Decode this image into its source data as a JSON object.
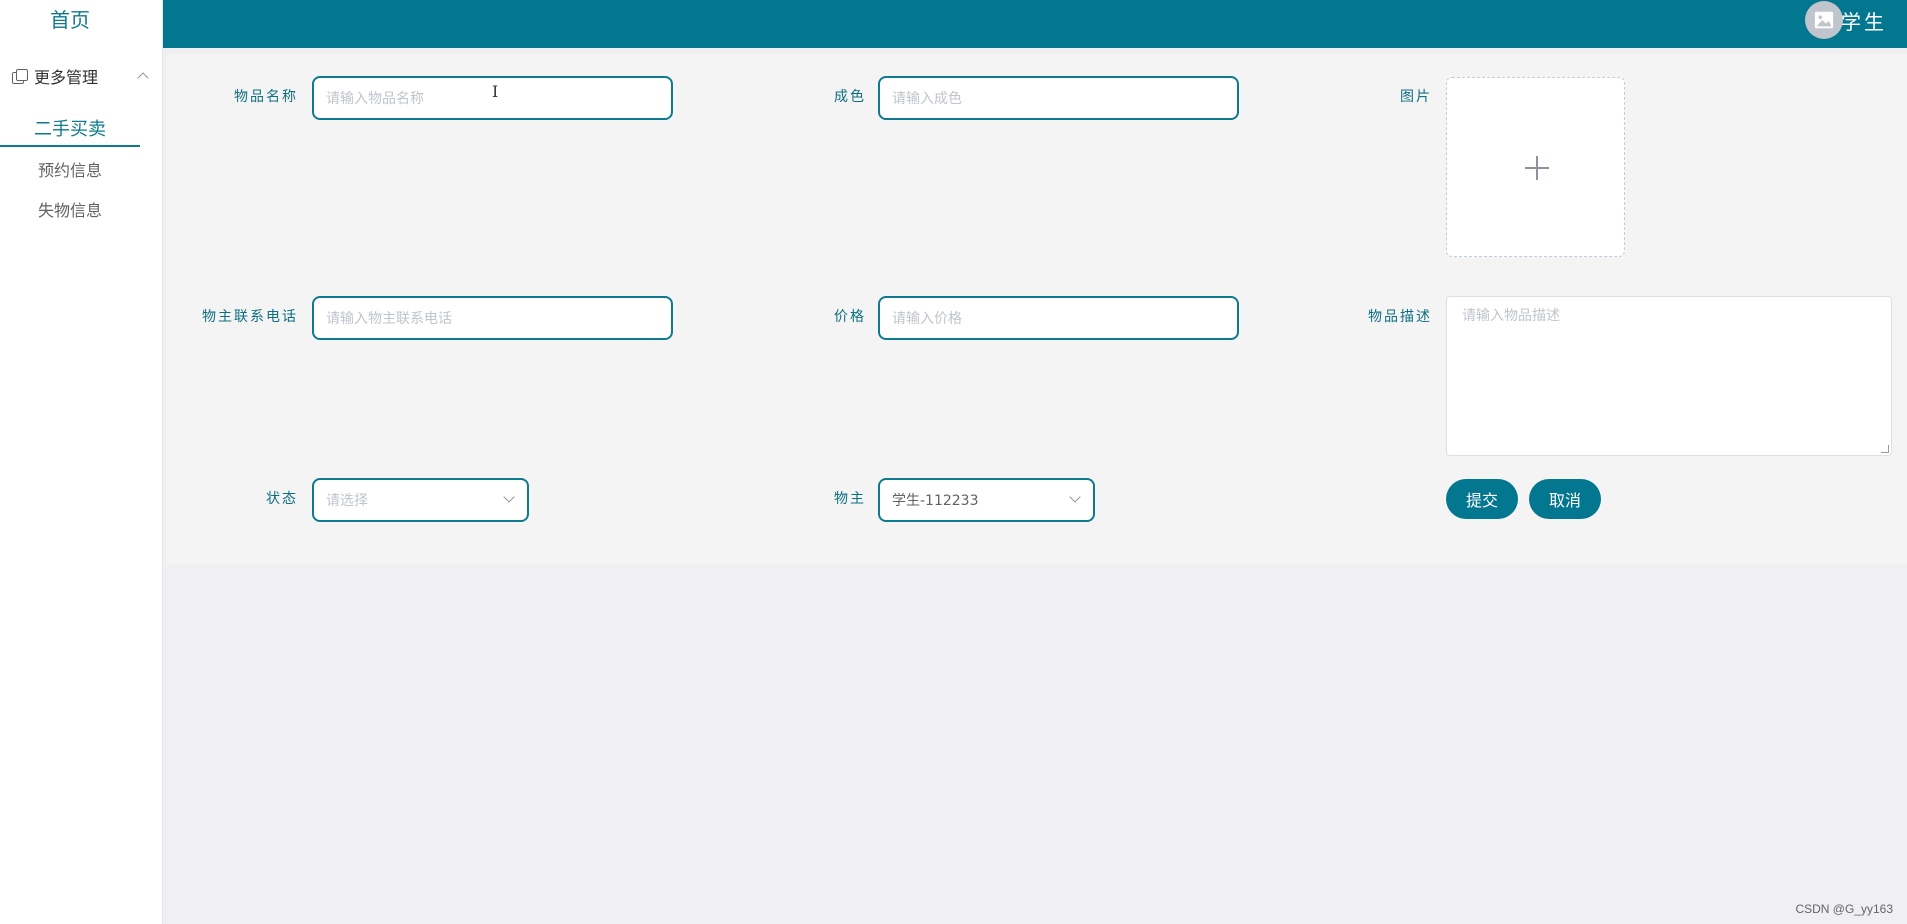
{
  "sidebar": {
    "home": "首页",
    "group_label": "更多管理",
    "items": [
      {
        "label": "二手买卖"
      },
      {
        "label": "预约信息"
      },
      {
        "label": "失物信息"
      }
    ]
  },
  "header": {
    "user_name": "学生"
  },
  "form": {
    "name": {
      "label": "物品名称",
      "placeholder": "请输入物品名称"
    },
    "condition": {
      "label": "成色",
      "placeholder": "请输入成色"
    },
    "image": {
      "label": "图片"
    },
    "phone": {
      "label": "物主联系电话",
      "placeholder": "请输入物主联系电话"
    },
    "price": {
      "label": "价格",
      "placeholder": "请输入价格"
    },
    "description": {
      "label": "物品描述",
      "placeholder": "请输入物品描述"
    },
    "status": {
      "label": "状态",
      "placeholder": "请选择"
    },
    "owner": {
      "label": "物主",
      "value": "学生-112233"
    },
    "submit_label": "提交",
    "cancel_label": "取消"
  },
  "watermark": "CSDN @G_yy163",
  "colors": {
    "accent": "#047790",
    "background": "#efeff4",
    "panel": "#f4f4f5"
  }
}
